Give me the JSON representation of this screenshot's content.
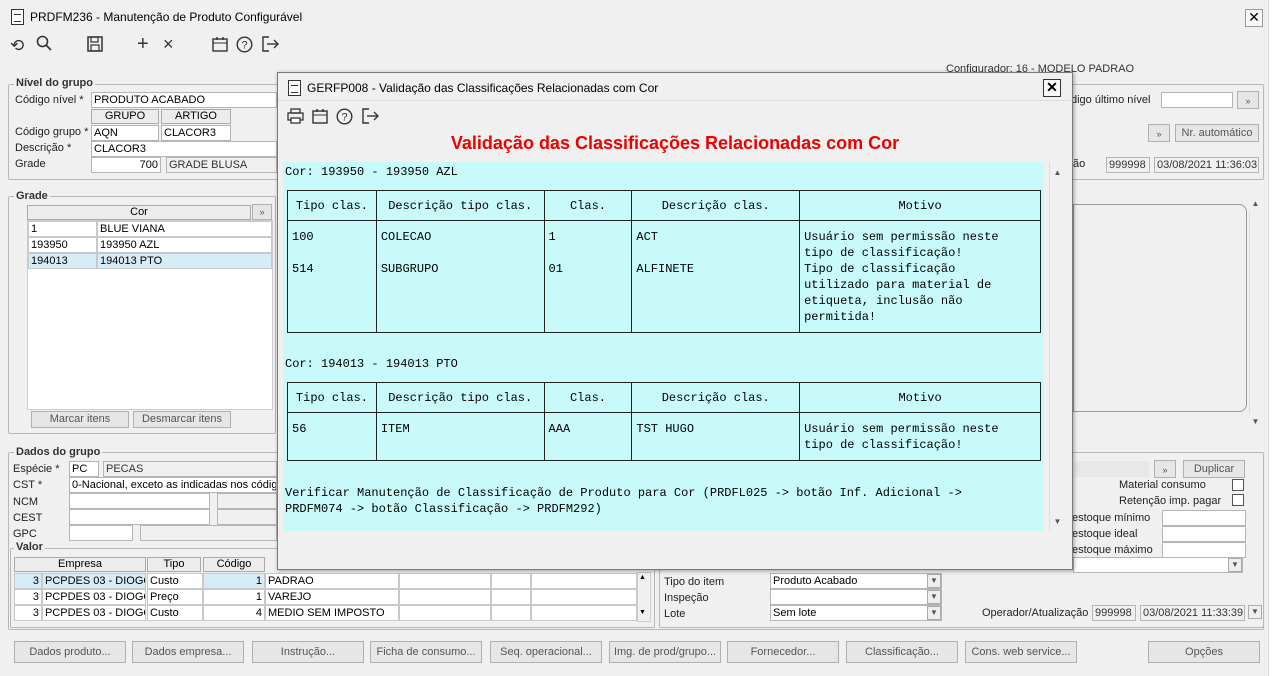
{
  "window": {
    "title": "PRDFM236 - Manutenção de Produto Configurável",
    "close": "✕"
  },
  "configurador": "Configurador: 16 - MODELO PADRAO",
  "nivel": {
    "legend": "Nível do grupo",
    "codigo_nivel_label": "Código nível *",
    "codigo_nivel_value": "PRODUTO ACABADO",
    "col_grupo": "GRUPO",
    "col_artigo": "ARTIGO",
    "codigo_grupo_label": "Código grupo *",
    "grupo_value": "AQN",
    "artigo_value": "CLACOR3",
    "descricao_label": "Descrição *",
    "descricao_value": "CLACOR3",
    "grade_label": "Grade",
    "grade_code": "700",
    "grade_desc": "GRADE BLUSA",
    "codigo_ultimo_label": "digo último nível",
    "nr_automatico": "Nr. automático",
    "operador_code": "999998",
    "operador_date": "03/08/2021 11:36:03",
    "ao_label": "ão"
  },
  "grade": {
    "legend": "Grade",
    "col_cor": "Cor",
    "rows": [
      {
        "code": "1",
        "desc": "BLUE VIANA"
      },
      {
        "code": "193950",
        "desc": "193950 AZL"
      },
      {
        "code": "194013",
        "desc": "194013 PTO"
      }
    ],
    "marcar": "Marcar itens",
    "desmarcar": "Desmarcar itens"
  },
  "dados": {
    "legend": "Dados do grupo",
    "especie_label": "Espécie *",
    "especie_code": "PC",
    "especie_desc": "PECAS",
    "cst_label": "CST *",
    "cst_value": "0-Nacional, exceto as indicadas nos códig",
    "ncm_label": "NCM",
    "cest_label": "CEST",
    "gpc_label": "GPC",
    "duplicar": "Duplicar",
    "material_consumo": "Material consumo",
    "retencao": "Retenção imp. pagar",
    "estoque_minimo": "estoque mínimo",
    "estoque_ideal": "estoque ideal",
    "estoque_maximo": "estoque máximo"
  },
  "valor": {
    "legend": "Valor",
    "headers": [
      "Empresa",
      "Tipo",
      "Código"
    ],
    "rows": [
      {
        "num": "3",
        "empresa": "PCPDES 03 - DIOGO",
        "tipo": "Custo",
        "codigo": "1",
        "desc": "PADRAO"
      },
      {
        "num": "3",
        "empresa": "PCPDES 03 - DIOGO",
        "tipo": "Preço",
        "codigo": "1",
        "desc": "VAREJO"
      },
      {
        "num": "3",
        "empresa": "PCPDES 03 - DIOGO",
        "tipo": "Custo",
        "codigo": "4",
        "desc": "MEDIO SEM IMPOSTO"
      }
    ]
  },
  "item": {
    "tipo_item_label": "Tipo do item",
    "tipo_item_value": "Produto Acabado",
    "inspecao_label": "Inspeção",
    "lote_label": "Lote",
    "lote_value": "Sem lote",
    "operador_label": "Operador/Atualização",
    "operador_code": "999998",
    "operador_date": "03/08/2021 11:33:39"
  },
  "bottom_buttons": [
    "Dados produto...",
    "Dados empresa...",
    "Instrução...",
    "Ficha de consumo...",
    "Seq. operacional...",
    "Img. de prod/grupo...",
    "Fornecedor...",
    "Classificação...",
    "Cons. web service...",
    "Opções"
  ],
  "modal": {
    "title": "GERFP008 - Validação das Classificações Relacionadas com Cor",
    "close": "✕",
    "heading": "Validação das Classificações Relacionadas com Cor",
    "heading_color": "#ee0000",
    "headers": [
      "Tipo clas.",
      "Descrição tipo clas.",
      "Clas.",
      "Descrição clas.",
      "Motivo"
    ],
    "cor1": "Cor: 193950 - 193950 AZL",
    "t1_tipo": "100\n\n514",
    "t1_desc_tipo": "COLECAO\n\nSUBGRUPO",
    "t1_clas": "1\n\n01",
    "t1_desc_clas": "ACT\n\nALFINETE",
    "t1_motivo": "Usuário sem permissão neste\ntipo de classificação!\nTipo de classificação\nutilizado para material de\netiqueta, inclusão não\npermitida!",
    "cor2": "Cor: 194013 - 194013 PTO",
    "t2_tipo": "56",
    "t2_desc_tipo": "ITEM",
    "t2_clas": "AAA",
    "t2_desc_clas": "TST HUGO",
    "t2_motivo": "Usuário sem permissão neste\ntipo de classificação!",
    "footer": "Verificar Manutenção de Classificação de Produto para Cor (PRDFL025 -> botão Inf. Adicional ->\nPRDFM074 -> botão Classificação -> PRDFM292)"
  },
  "icons": [
    "refresh-icon",
    "search-icon",
    "save-icon",
    "add-icon",
    "delete-icon",
    "calendar-icon",
    "help-icon",
    "exit-icon",
    "print-icon"
  ]
}
